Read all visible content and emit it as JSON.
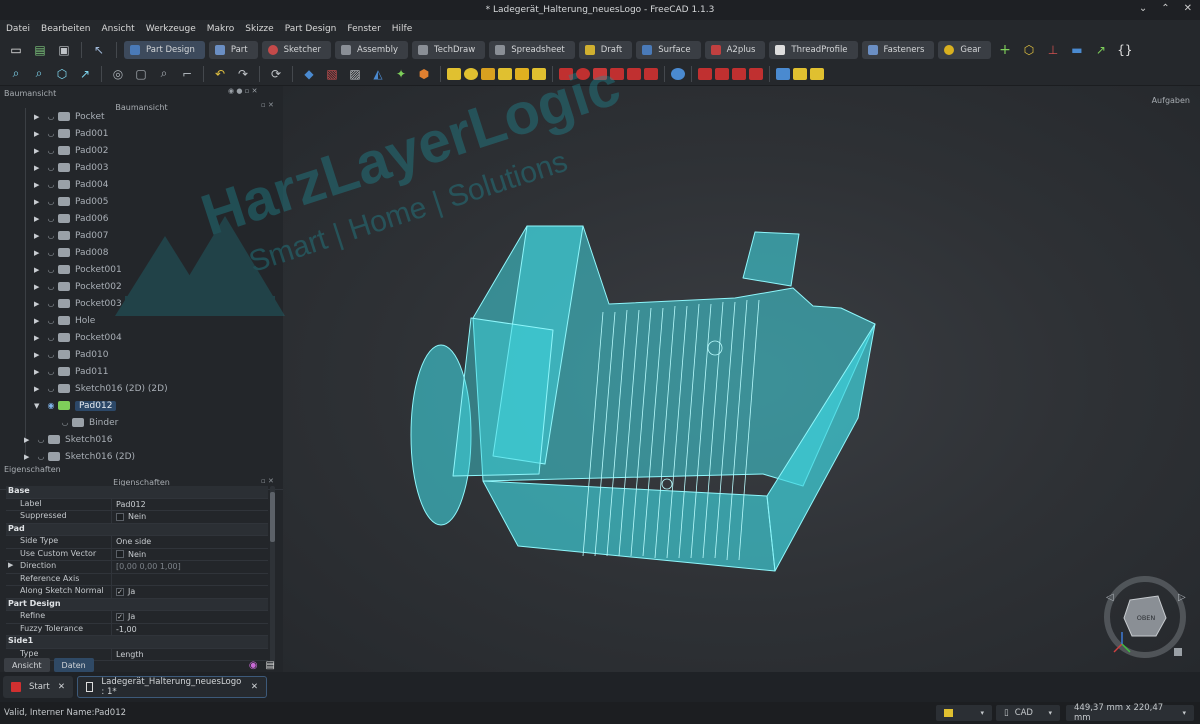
{
  "window": {
    "title": "* Ladegerät_Halterung_neuesLogo - FreeCAD 1.1.3"
  },
  "menu": [
    "Datei",
    "Bearbeiten",
    "Ansicht",
    "Werkzeuge",
    "Makro",
    "Skizze",
    "Part Design",
    "Fenster",
    "Hilfe"
  ],
  "workbenches": [
    {
      "label": "Part Design",
      "color": "#4a7ab8"
    },
    {
      "label": "Part",
      "color": "#6b8fc4"
    },
    {
      "label": "Sketcher",
      "color": "#c44a4a"
    },
    {
      "label": "Assembly",
      "color": "#8a8f96"
    },
    {
      "label": "TechDraw",
      "color": "#8a8f96"
    },
    {
      "label": "Spreadsheet",
      "color": "#8a8f96"
    },
    {
      "label": "Draft",
      "color": "#d0b030"
    },
    {
      "label": "Surface",
      "color": "#4a7ab8"
    },
    {
      "label": "A2plus",
      "color": "#c04040"
    },
    {
      "label": "ThreadProfile",
      "color": "#dddddd"
    },
    {
      "label": "Fasteners",
      "color": "#6b8fc4"
    },
    {
      "label": "Gear",
      "color": "#d8b020"
    }
  ],
  "left_panel": {
    "top_label": "Baumansicht",
    "tree_header": "Baumansicht",
    "tree_items": [
      {
        "label": "Pocket",
        "indent": 2
      },
      {
        "label": "Pad001",
        "indent": 2
      },
      {
        "label": "Pad002",
        "indent": 2
      },
      {
        "label": "Pad003",
        "indent": 2
      },
      {
        "label": "Pad004",
        "indent": 2
      },
      {
        "label": "Pad005",
        "indent": 2
      },
      {
        "label": "Pad006",
        "indent": 2
      },
      {
        "label": "Pad007",
        "indent": 2
      },
      {
        "label": "Pad008",
        "indent": 2
      },
      {
        "label": "Pocket001",
        "indent": 2
      },
      {
        "label": "Pocket002",
        "indent": 2
      },
      {
        "label": "Pocket003",
        "indent": 2
      },
      {
        "label": "Hole",
        "indent": 2
      },
      {
        "label": "Pocket004",
        "indent": 2
      },
      {
        "label": "Pad010",
        "indent": 2
      },
      {
        "label": "Pad011",
        "indent": 2
      },
      {
        "label": "Sketch016 (2D) (2D)",
        "indent": 2
      },
      {
        "label": "Pad012",
        "indent": 2,
        "selected": true
      },
      {
        "label": "Binder",
        "indent": 3
      },
      {
        "label": "Sketch016",
        "indent": 1
      },
      {
        "label": "Sketch016 (2D)",
        "indent": 1
      }
    ]
  },
  "properties": {
    "top_label": "Eigenschaften",
    "header": "Eigenschaften",
    "rows": [
      {
        "type": "group",
        "key": "Base"
      },
      {
        "key": "Label",
        "value": "Pad012"
      },
      {
        "key": "Suppressed",
        "value": "Nein",
        "check": ""
      },
      {
        "type": "group",
        "key": "Pad"
      },
      {
        "key": "Side Type",
        "value": "One side"
      },
      {
        "key": "Use Custom Vector",
        "value": "Nein",
        "check": ""
      },
      {
        "key": "Direction",
        "value": "[0,00 0,00 1,00]",
        "dim": true
      },
      {
        "key": "Reference Axis",
        "value": ""
      },
      {
        "key": "Along Sketch Normal",
        "value": "Ja",
        "check": "✓"
      },
      {
        "type": "group",
        "key": "Part Design"
      },
      {
        "key": "Refine",
        "value": "Ja",
        "check": "✓"
      },
      {
        "key": "Fuzzy Tolerance",
        "value": "-1,00"
      },
      {
        "type": "group",
        "key": "Side1"
      },
      {
        "key": "Type",
        "value": "Length"
      }
    ],
    "tab_view": "Ansicht",
    "tab_data": "Daten"
  },
  "viewport": {
    "tasks_label": "Aufgaben",
    "watermark_line1": "HarzLayerLogic",
    "watermark_line2": "Smart | Home | Solutions",
    "navcube_face": "OBEN",
    "model_color": "#3fe0e8"
  },
  "doc_tabs": [
    {
      "label": "Start"
    },
    {
      "label": "Ladegerät_Halterung_neuesLogo : 1*",
      "active": true
    }
  ],
  "status": {
    "left": "Valid, Interner Name:Pad012",
    "nav_style": "CAD",
    "dimensions": "449,37 mm x 220,47 mm"
  }
}
